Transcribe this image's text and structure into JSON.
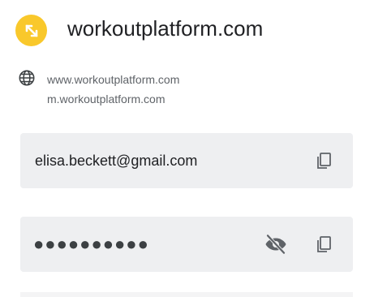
{
  "site": {
    "title": "workoutplatform.com",
    "icon": "expand-arrows-icon",
    "icon_color": "#F9C82B"
  },
  "urls": [
    "www.workoutplatform.com",
    "m.workoutplatform.com"
  ],
  "credentials": {
    "username": "elisa.beckett@gmail.com",
    "password_masked": "●●●●●●●●●●"
  },
  "icons": {
    "globe": "globe-icon",
    "copy": "copy-icon",
    "visibility": "eye-off-icon"
  },
  "colors": {
    "field_background": "#eeeff1",
    "text": "#202124",
    "secondary_text": "#5f6368",
    "icon": "#5f6368"
  }
}
